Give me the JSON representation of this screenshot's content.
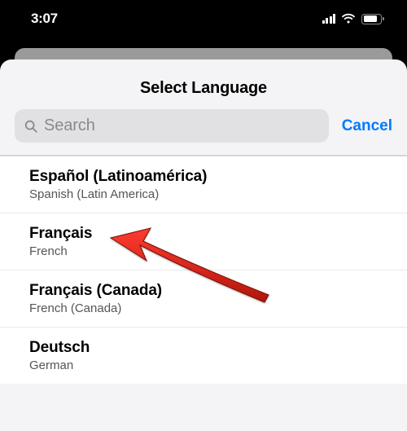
{
  "statusBar": {
    "time": "3:07"
  },
  "sheet": {
    "title": "Select Language",
    "search": {
      "placeholder": "Search"
    },
    "cancel": "Cancel"
  },
  "languages": [
    {
      "native": "Español (Latinoamérica)",
      "english": "Spanish (Latin America)"
    },
    {
      "native": "Français",
      "english": "French"
    },
    {
      "native": "Français (Canada)",
      "english": "French (Canada)"
    },
    {
      "native": "Deutsch",
      "english": "German"
    }
  ]
}
